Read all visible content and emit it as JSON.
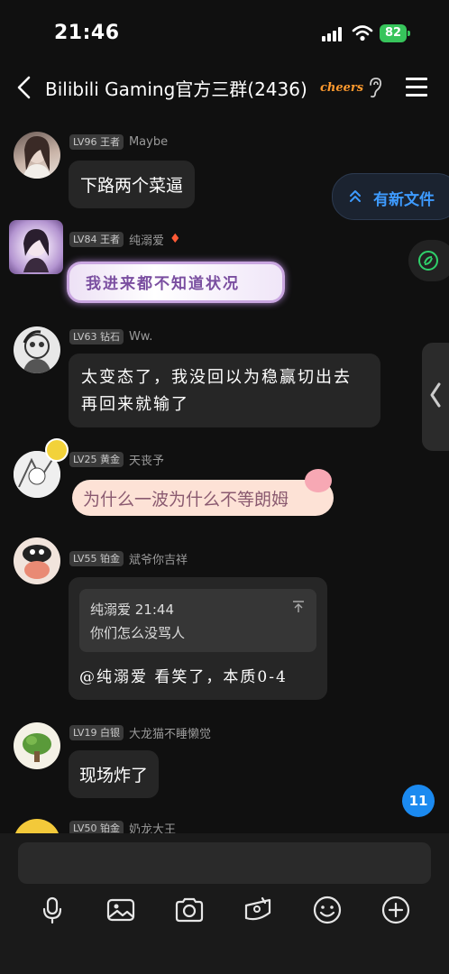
{
  "status_bar": {
    "time": "21:46",
    "battery": "82"
  },
  "nav": {
    "title": "Bilibili Gaming官方三群(2436)",
    "badge": "cheers"
  },
  "floating": {
    "new_files": "有新文件",
    "unread_count": "11"
  },
  "messages": [
    {
      "level": "LV96 王者",
      "name": "Maybe",
      "text": "下路两个菜逼"
    },
    {
      "level": "LV84 王者",
      "name": "纯溺爱",
      "text": "我进来都不知道状况"
    },
    {
      "level": "LV63 钻石",
      "name": "Ww.",
      "line1": "太变态了，我没回以为稳赢切出去",
      "line2": "再回来就输了"
    },
    {
      "level": "LV25 黄金",
      "name": "天丧予",
      "text": "为什么一波为什么不等朗姆"
    },
    {
      "level": "LV55 铂金",
      "name": "斌爷你吉祥",
      "quote_author": "纯溺爱 21:44",
      "quote_text": "你们怎么没骂人",
      "text": "@纯溺爱 看笑了，本质0-4"
    },
    {
      "level": "LV19 白银",
      "name": "大龙猫不睡懒觉",
      "text": "现场炸了"
    },
    {
      "level": "LV50 铂金",
      "name": "奶龙大王"
    }
  ],
  "toolbar": [
    "microphone-icon",
    "image-icon",
    "camera-icon",
    "red-packet-icon",
    "emoji-icon",
    "plus-icon"
  ],
  "colors": {
    "background": "#101010",
    "bubble": "#262626",
    "accent": "#3e9bff",
    "battery": "#37c45b"
  }
}
